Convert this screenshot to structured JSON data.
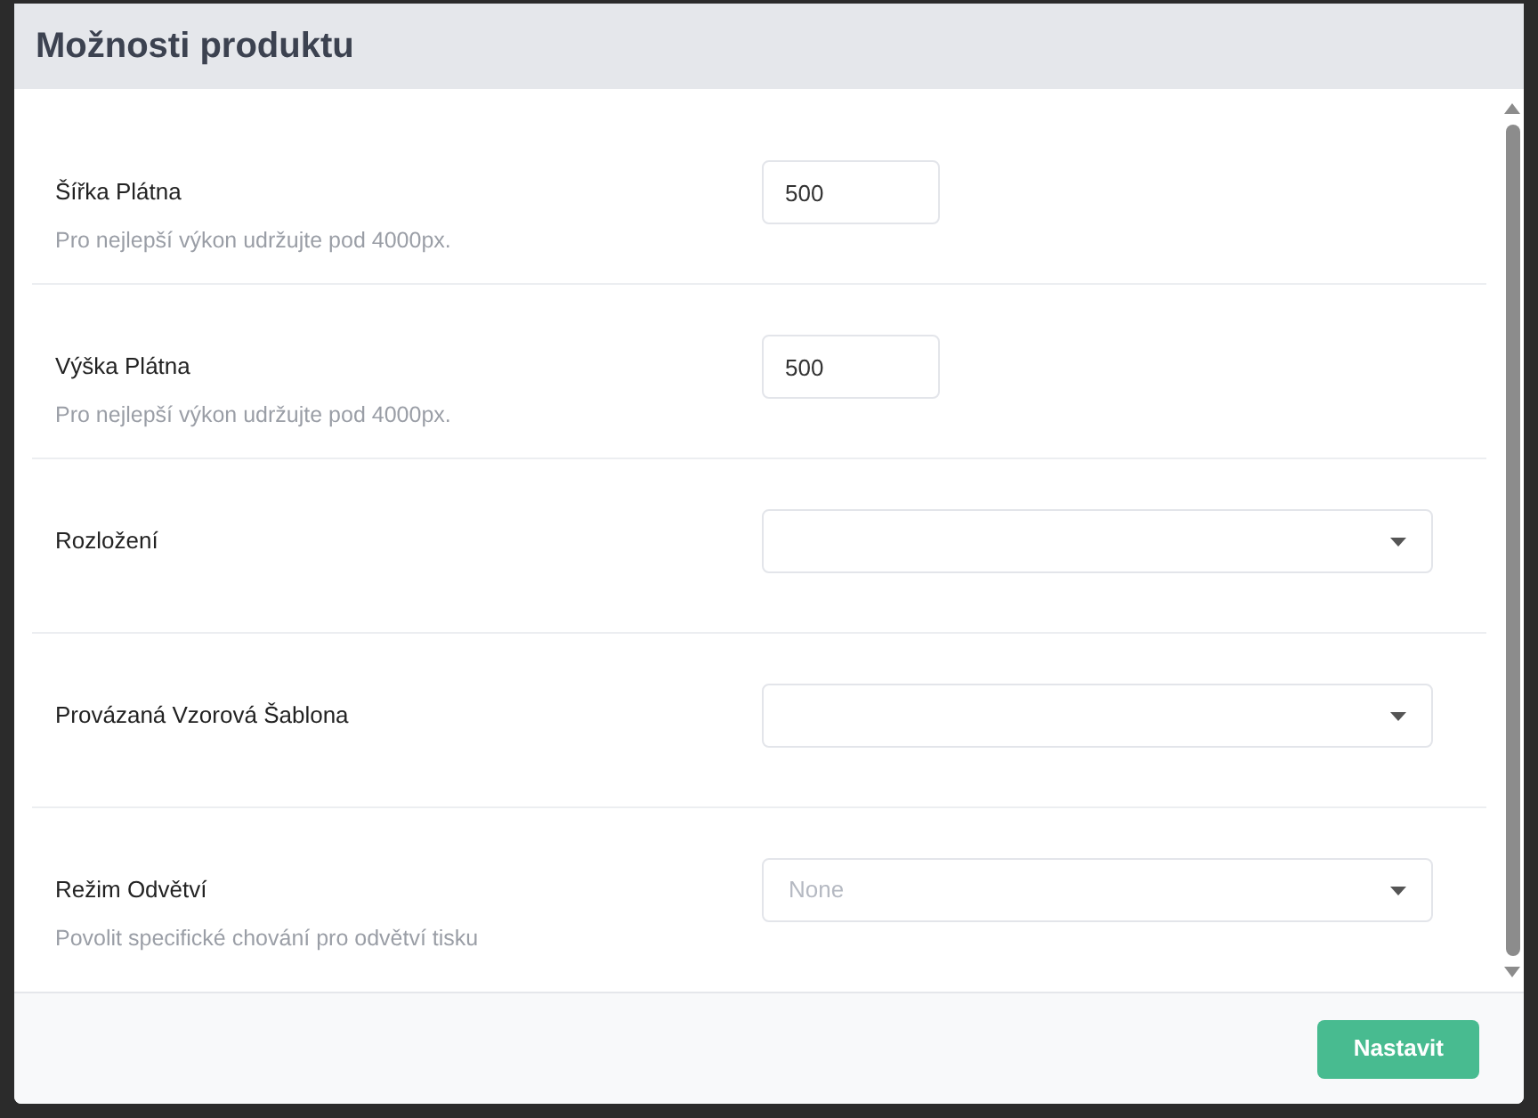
{
  "dialog": {
    "title": "Možnosti produktu",
    "rows": [
      {
        "label": "Šířka Plátna",
        "hint": "Pro nejlepší výkon udržujte pod 4000px.",
        "field": {
          "kind": "text",
          "value": "500"
        }
      },
      {
        "label": "Výška Plátna",
        "hint": "Pro nejlepší výkon udržujte pod 4000px.",
        "field": {
          "kind": "text",
          "value": "500"
        }
      },
      {
        "label": "Rozložení",
        "field": {
          "kind": "select"
        }
      },
      {
        "label": "Provázaná Vzorová Šablona",
        "field": {
          "kind": "select"
        }
      },
      {
        "label": "Režim Odvětví",
        "hint": "Povolit specifické chování pro odvětví tisku",
        "field": {
          "kind": "select",
          "placeholder": "None"
        }
      }
    ],
    "buttons": [
      "Nastavit"
    ]
  }
}
